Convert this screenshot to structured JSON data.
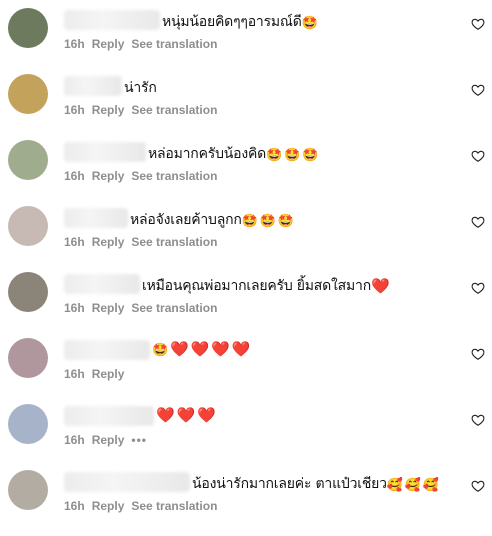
{
  "comments": [
    {
      "text": "หนุ่มน้อยคิดๆๆอารมณ์ดี",
      "emojis": [
        "🤩"
      ],
      "time": "16h",
      "reply": "Reply",
      "translate": "See translation",
      "avatar_color": "#6e7a5e",
      "name_width": 96
    },
    {
      "text": "น่ารัก",
      "emojis": [],
      "time": "16h",
      "reply": "Reply",
      "translate": "See translation",
      "avatar_color": "#c3a35c",
      "name_width": 58
    },
    {
      "text": "หล่อมากครับน้องคิด",
      "emojis": [
        "🤩",
        "🤩",
        "🤩"
      ],
      "time": "16h",
      "reply": "Reply",
      "translate": "See translation",
      "avatar_color": "#9fac8e",
      "name_width": 82
    },
    {
      "text": "หล่อจังเลยค้าบลูกก",
      "emojis": [
        "🤩",
        "🤩",
        "🤩"
      ],
      "time": "16h",
      "reply": "Reply",
      "translate": "See translation",
      "avatar_color": "#c7b9b4",
      "name_width": 64
    },
    {
      "text": "เหมือนคุณพ่อมากเลยครับ ยิ้มสดใสมาก",
      "emojis": [
        "❤️"
      ],
      "time": "16h",
      "reply": "Reply",
      "translate": "See translation",
      "avatar_color": "#8a8479",
      "name_width": 76
    },
    {
      "text": "",
      "emojis": [
        "🤩",
        "❤️",
        "❤️",
        "❤️",
        "❤️"
      ],
      "time": "16h",
      "reply": "Reply",
      "translate": "",
      "avatar_color": "#b0969d",
      "name_width": 86
    },
    {
      "text": "",
      "emojis": [
        "❤️",
        "❤️",
        "❤️"
      ],
      "time": "16h",
      "reply": "Reply",
      "translate": "",
      "more": "•••",
      "avatar_color": "#a6b3c9",
      "name_width": 90
    },
    {
      "text": "น้องน่ารักมากเลยค่ะ ตาแป๋วเชียว",
      "emojis": [
        "🥰",
        "🥰",
        "🥰"
      ],
      "time": "16h",
      "reply": "Reply",
      "translate": "See translation",
      "avatar_color": "#b3aca2",
      "name_width": 126
    }
  ]
}
